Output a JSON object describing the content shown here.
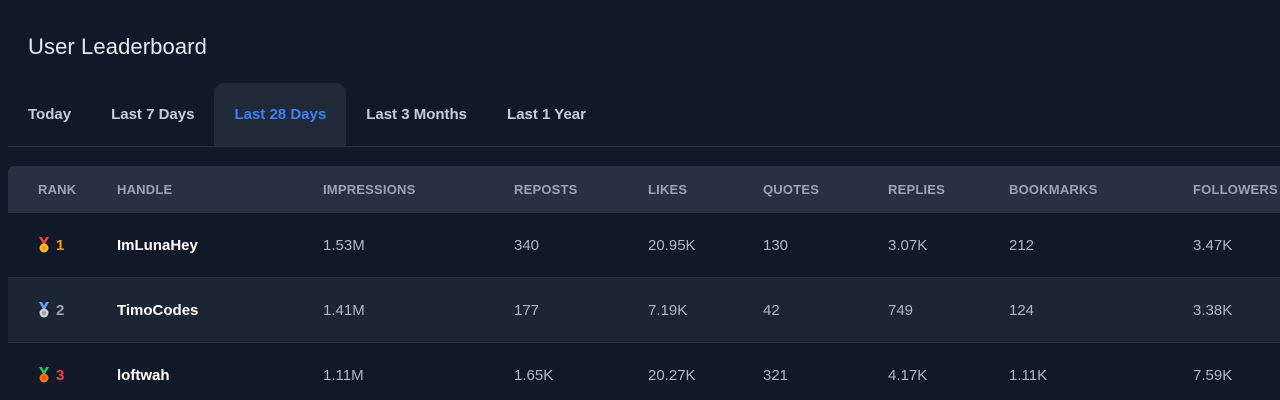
{
  "leaderboard": {
    "title": "User Leaderboard",
    "tabs": [
      {
        "label": "Today",
        "active": false
      },
      {
        "label": "Last 7 Days",
        "active": false
      },
      {
        "label": "Last 28 Days",
        "active": true
      },
      {
        "label": "Last 3 Months",
        "active": false
      },
      {
        "label": "Last 1 Year",
        "active": false
      }
    ],
    "columns": {
      "rank": "RANK",
      "handle": "HANDLE",
      "impressions": "IMPRESSIONS",
      "reposts": "REPOSTS",
      "likes": "LIKES",
      "quotes": "QUOTES",
      "replies": "REPLIES",
      "bookmarks": "BOOKMARKS",
      "followers": "FOLLOWERS"
    },
    "rows": [
      {
        "rank": "1",
        "medal": "gold-medal-icon",
        "rank_color": "#f59e0b",
        "ribbon": "#ef4444",
        "medal_color": "#fbbf24",
        "handle": "ImLunaHey",
        "impressions": "1.53M",
        "reposts": "340",
        "likes": "20.95K",
        "quotes": "130",
        "replies": "3.07K",
        "bookmarks": "212",
        "followers": "3.47K"
      },
      {
        "rank": "2",
        "medal": "silver-medal-icon",
        "rank_color": "#9ca3af",
        "ribbon": "#60a5fa",
        "medal_color": "#d1d5db",
        "handle": "TimoCodes",
        "impressions": "1.41M",
        "reposts": "177",
        "likes": "7.19K",
        "quotes": "42",
        "replies": "749",
        "bookmarks": "124",
        "followers": "3.38K"
      },
      {
        "rank": "3",
        "medal": "bronze-medal-icon",
        "rank_color": "#ef4444",
        "ribbon": "#22c55e",
        "medal_color": "#f97316",
        "handle": "loftwah",
        "impressions": "1.11M",
        "reposts": "1.65K",
        "likes": "20.27K",
        "quotes": "321",
        "replies": "4.17K",
        "bookmarks": "1.11K",
        "followers": "7.59K"
      }
    ]
  }
}
